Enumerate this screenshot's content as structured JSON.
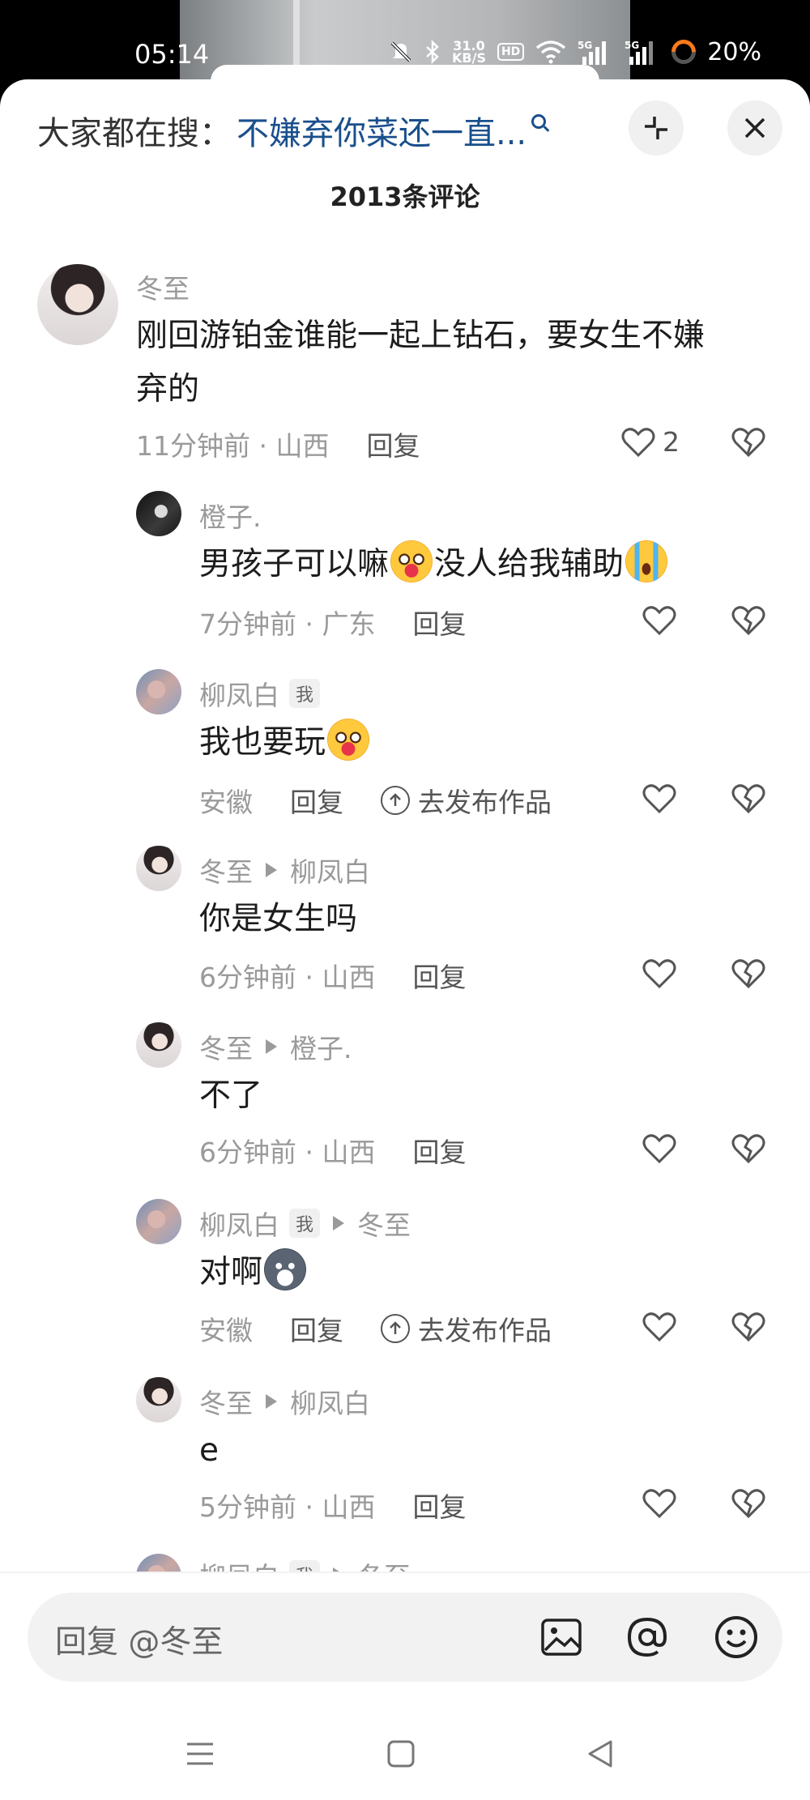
{
  "status_bar": {
    "time": "05:14",
    "net_speed": "31.0\nKB/S",
    "hd": "HD",
    "signal1": "5G",
    "signal2": "5G",
    "battery": "20%"
  },
  "search": {
    "prefix": "大家都在搜：",
    "term": "不嫌弃你菜还一直..."
  },
  "header": {
    "comment_count": "2013条评论"
  },
  "comments": [
    {
      "user": "冬至",
      "text_line1": "刚回游铂金谁能一起上钻石，要女生不嫌",
      "text_line2": "弃的",
      "time_loc": "11分钟前 · 山西",
      "reply": "回复",
      "likes": "2"
    },
    {
      "user": "橙子.",
      "text_a": "男孩子可以嘛",
      "text_b": "没人给我辅助",
      "time_loc": "7分钟前 · 广东",
      "reply": "回复"
    },
    {
      "user": "柳凤白",
      "me_tag": "我",
      "text": "我也要玩",
      "time_loc": "安徽",
      "reply": "回复",
      "publish": "去发布作品"
    },
    {
      "user": "冬至",
      "reply_to": "柳凤白",
      "text": "你是女生吗",
      "time_loc": "6分钟前 · 山西",
      "reply": "回复"
    },
    {
      "user": "冬至",
      "reply_to": "橙子.",
      "text": "不了",
      "time_loc": "6分钟前 · 山西",
      "reply": "回复"
    },
    {
      "user": "柳凤白",
      "me_tag": "我",
      "reply_to": "冬至",
      "text": "对啊",
      "time_loc": "安徽",
      "reply": "回复",
      "publish": "去发布作品"
    },
    {
      "user": "冬至",
      "reply_to": "柳凤白",
      "text": "e",
      "time_loc": "5分钟前 · 山西",
      "reply": "回复"
    },
    {
      "user": "柳凤白",
      "me_tag": "我",
      "reply_to": "冬至"
    }
  ],
  "input": {
    "placeholder": "回复 @冬至"
  },
  "icons": {
    "like": "heart-outline-icon",
    "dislike": "broken-heart-icon",
    "image": "image-icon",
    "mention": "at-icon",
    "emoji": "smiley-icon"
  },
  "colors": {
    "link": "#1a4f8c",
    "muted": "#9a9a9a",
    "text": "#1c1c1c"
  }
}
